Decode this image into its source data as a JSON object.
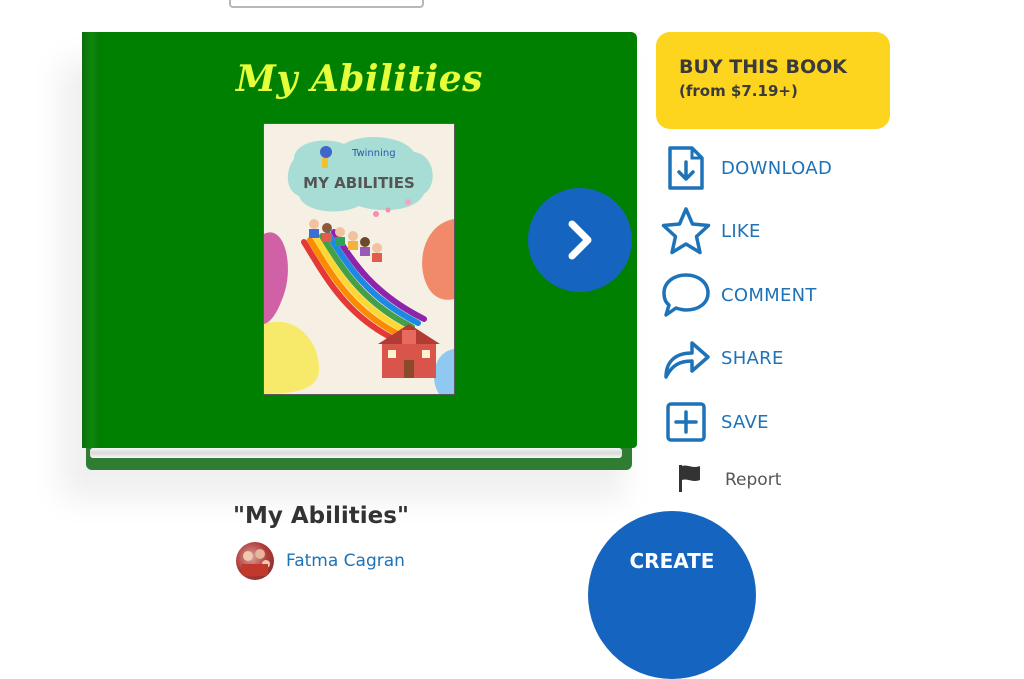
{
  "book": {
    "cover_title": "My Abilities",
    "cover_image": {
      "brand": "Twinning",
      "heading": "MY ABILITIES"
    },
    "title": "\"My Abilities\"",
    "author": "Fatma Cagran"
  },
  "actions": {
    "buy_title": "BUY THIS BOOK",
    "buy_price": "(from $7.19+)",
    "download": "DOWNLOAD",
    "like": "LIKE",
    "comment": "COMMENT",
    "share": "SHARE",
    "save": "SAVE",
    "report": "Report"
  },
  "create": {
    "label": "CREATE"
  },
  "icons": {
    "next": "chevron-right-icon",
    "download": "download-file-icon",
    "like": "star-icon",
    "comment": "speech-bubble-icon",
    "share": "share-arrow-icon",
    "save": "plus-square-icon",
    "report": "flag-icon"
  },
  "colors": {
    "cover": "#008000",
    "cover_title": "#e6ff3b",
    "accent_blue": "#1565c0",
    "action_text": "#1e73b8",
    "buy_button": "#fdd51f"
  }
}
